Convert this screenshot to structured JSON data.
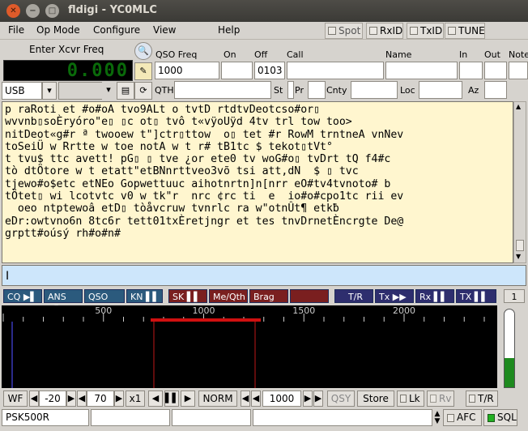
{
  "window": {
    "title": "fldigi - YC0MLC"
  },
  "menu": [
    "File",
    "Op Mode",
    "Configure",
    "View",
    "Help"
  ],
  "toolbar_toggles": [
    "Spot",
    "RxID",
    "TxID",
    "TUNE"
  ],
  "xcvr": {
    "label": "Enter Xcvr Freq",
    "freq": "0.000",
    "mode": "USB"
  },
  "log": {
    "qso_freq_label": "QSO Freq",
    "qso_freq": "1000",
    "on_label": "On",
    "on": "",
    "off_label": "Off",
    "off": "0103",
    "call_label": "Call",
    "name_label": "Name",
    "in_label": "In",
    "out_label": "Out",
    "notes_label": "Note",
    "qth_label": "QTH",
    "st_label": "St",
    "pr_label": "Pr",
    "cnty_label": "Cnty",
    "loc_label": "Loc",
    "az_label": "Az"
  },
  "rx_text": "p raRoti et #o#oA tvo9ALt o tvtD rtdtvDeotcso#or▯\nwvvnb▯soÈryóro\"e▯ ▯c ot▯ tvô t«vÿoUÿd 4tv trl tow too>\nnitDeot«g#r ª twooew t\"]ctr▯ttow  o▯ tet #r RowM trntneA vnNev\ntoSeiÜ w Rrtte w toe notA w t r# tB1tc $ tekot▯tVt°\nt tvu$ ttc avett! pG▯ ▯ tve ¿or ete0 tv woG#o▯ tvDrt tQ f4#c\ntò dtÖtore w t etatt\"etBNnrttveo3võ tsi att,dN  $ ▯ tvc\ntjewo#o$etc etNEo Gopwettuuc aihotnrtn]n[nrr eO#tv4tvnoto# b\ntÖtet▯ wi lcotvtc v0 w tk\"r  nrc ¢rc ti  e  io#o#cpo1tc rii ev\n  oeo ntptewoâ etD▯ tòåvcruw tvnrlc ra w\"otnÛt¶ etkƀ\neDr:owtvno6n 8tc6r tett01txÈretjngr et tes tnvDrnetÈncrgte De@\ngrptt#oúsý rh#o#n#",
  "macros": [
    "CQ",
    "ANS",
    "QSO",
    "KN",
    "SK",
    "Me/Qth",
    "Brag",
    "",
    "T/R",
    "Tx",
    "Rx",
    "TX"
  ],
  "macro_set": "1",
  "waterfall": {
    "ticks": [
      "500",
      "1000",
      "1500",
      "2000"
    ],
    "signal_level": 0.37
  },
  "controls": {
    "wf": "WF",
    "ref": "-20",
    "range": "70",
    "zoom": "x1",
    "speed": "NORM",
    "freq": "1000",
    "qsy": "QSY",
    "store": "Store",
    "lk": "Lk",
    "rv": "Rv",
    "tr": "T/R"
  },
  "status": {
    "mode": "PSK500R",
    "afc": "AFC",
    "sql": "SQL"
  }
}
